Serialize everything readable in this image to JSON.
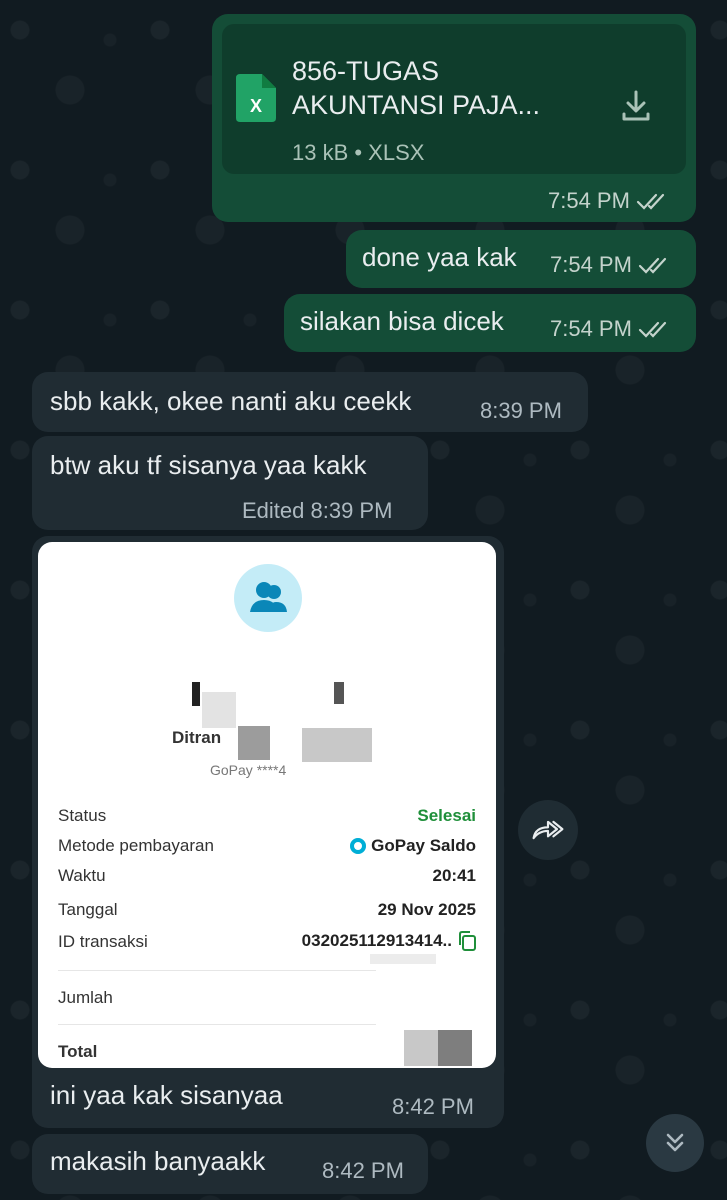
{
  "messages": {
    "file": {
      "name": "856-TUGAS AKUNTANSI PAJA...",
      "name_line1": "856-TUGAS",
      "name_line2": "AKUNTANSI PAJA...",
      "info": "13 kB • XLSX",
      "icon_letter": "X",
      "time": "7:54 PM"
    },
    "out_1": {
      "text": "done yaa kak",
      "time": "7:54 PM"
    },
    "out_2": {
      "text": "silakan bisa dicek",
      "time": "7:54 PM"
    },
    "in_1": {
      "text": "sbb kakk, okee nanti aku ceekk",
      "time": "8:39 PM"
    },
    "in_2": {
      "text": "btw aku tf sisanya yaa kakk",
      "time": "Edited 8:39 PM"
    },
    "in_3": {
      "text": "ini yaa kak sisanyaa",
      "time": "8:42 PM"
    },
    "in_4": {
      "text": "makasih banyaakk",
      "time": "8:42 PM"
    }
  },
  "receipt": {
    "sender_partial": "Ditran",
    "wallet_masked": "GoPay ****4",
    "rows": {
      "status_label": "Status",
      "status_value": "Selesai",
      "method_label": "Metode pembayaran",
      "method_value": "GoPay Saldo",
      "time_label": "Waktu",
      "time_value": "20:41",
      "date_label": "Tanggal",
      "date_value": "29 Nov 2025",
      "txid_label": "ID transaksi",
      "txid_value": "032025112913414..",
      "amount_label": "Jumlah",
      "total_label": "Total"
    }
  },
  "colors": {
    "outgoing_bubble": "#144d37",
    "incoming_bubble": "#202c33",
    "status_success": "#1f8f3a"
  },
  "icons": {
    "file": "excel-file-icon",
    "download": "download-icon",
    "read": "double-check-icon",
    "forward": "forward-icon",
    "scroll": "scroll-down-icon"
  }
}
